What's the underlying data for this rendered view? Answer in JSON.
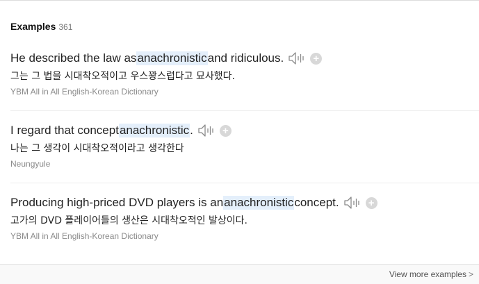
{
  "header": {
    "title": "Examples",
    "count": "361"
  },
  "examples": [
    {
      "en_before": "He described the law as ",
      "en_highlight": "anachronistic",
      "en_after": " and ridiculous.",
      "ko": "그는 그 법을 시대착오적이고 우스꽝스럽다고 묘사했다.",
      "source": "YBM All in All English-Korean Dictionary"
    },
    {
      "en_before": "I regard that concept ",
      "en_highlight": "anachronistic",
      "en_after": ".",
      "ko": "나는 그 생각이 시대착오적이라고 생각한다",
      "source": "Neungyule"
    },
    {
      "en_before": "Producing high-priced DVD players is an ",
      "en_highlight": "anachronistic",
      "en_after": " concept.",
      "ko": "고가의 DVD 플레이어들의 생산은 시대착오적인 발상이다.",
      "source": "YBM All in All English-Korean Dictionary"
    }
  ],
  "footer": {
    "more_label": "View more examples",
    "chevron": ">"
  },
  "icons": {
    "speaker": "speaker-icon",
    "add": "plus-circle-icon"
  },
  "colors": {
    "highlight": "#e4effb",
    "source_text": "#8a8a8a"
  }
}
